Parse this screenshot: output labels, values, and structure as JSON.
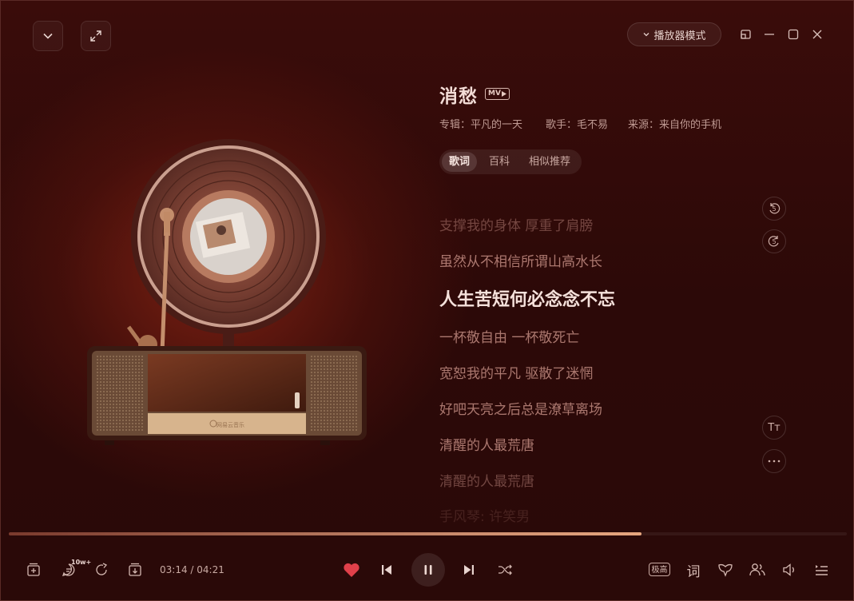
{
  "header": {
    "mode_label": "播放器模式",
    "icons": [
      "chevron-down-icon",
      "expand-icon",
      "mini-window-icon",
      "minimize-icon",
      "maximize-icon",
      "close-icon"
    ]
  },
  "song": {
    "title": "消愁",
    "mv_badge": "MV",
    "album_label": "专辑：平凡的一天",
    "singer_label": "歌手：毛不易",
    "source_label": "来源：来自你的手机"
  },
  "tabs": [
    {
      "label": "歌词",
      "active": true
    },
    {
      "label": "百科",
      "active": false
    },
    {
      "label": "相似推荐",
      "active": false
    }
  ],
  "lyrics": [
    {
      "text": "支撑我的身体 厚重了肩膀",
      "current": false
    },
    {
      "text": "虽然从不相信所谓山高水长",
      "current": false
    },
    {
      "text": "人生苦短何必念念不忘",
      "current": true
    },
    {
      "text": "一杯敬自由 一杯敬死亡",
      "current": false
    },
    {
      "text": "宽恕我的平凡 驱散了迷惘",
      "current": false
    },
    {
      "text": "好吧天亮之后总是潦草离场",
      "current": false
    },
    {
      "text": "清醒的人最荒唐",
      "current": false
    },
    {
      "text": "清醒的人最荒唐",
      "current": false
    },
    {
      "text": "手风琴: 许笑男",
      "current": false
    }
  ],
  "side_controls": {
    "back_label": "5",
    "forward_label": "5",
    "font_icon": "Tт",
    "more_icon": "more-icon"
  },
  "player": {
    "progress": 0.755,
    "time_current": "03:14",
    "time_total": "04:21",
    "time_display": "03:14 / 04:21",
    "comment_count": "10w+",
    "quality_label": "极高",
    "lyric_button": "词",
    "accent": "#e0404a"
  },
  "record": {
    "brand_text": "网易云音乐"
  }
}
